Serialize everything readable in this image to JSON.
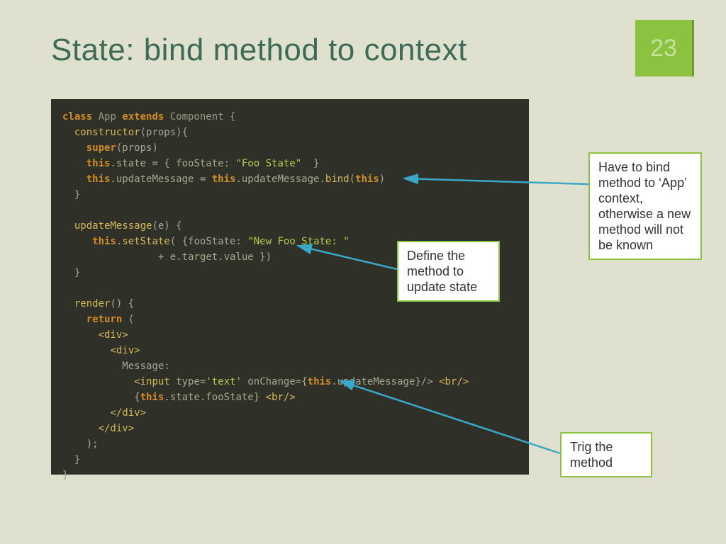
{
  "page_number": "23",
  "title": "State: bind method to context",
  "callouts": {
    "bind_note": "Have to bind method to ‘App’ context, otherwise a new method will not be known",
    "define_note": "Define the method to update state",
    "trig_note": "Trig the method"
  },
  "code": {
    "l1": {
      "a": "class ",
      "b": "App ",
      "c": "extends ",
      "d": "Component {"
    },
    "l2": {
      "a": "  ",
      "b": "constructor",
      "c": "(props){"
    },
    "l3": {
      "a": "    ",
      "b": "super",
      "c": "(props)"
    },
    "l4": {
      "a": "    ",
      "b": "this",
      "c": ".state = { fooState: ",
      "d": "\"Foo State\"",
      "e": "  }"
    },
    "l5": {
      "a": "    ",
      "b": "this",
      "c": ".updateMessage = ",
      "d": "this",
      "e": ".updateMessage.",
      "f": "bind",
      "g": "(",
      "h": "this",
      "i": ")"
    },
    "l6": "  }",
    "l7": "",
    "l8": {
      "a": "  ",
      "b": "updateMessage",
      "c": "(e) {"
    },
    "l9": {
      "a": "     ",
      "b": "this",
      "c": ".",
      "d": "setState",
      "e": "( {fooState: ",
      "f": "\"New Foo State: \""
    },
    "l10": {
      "a": "                + e.target.value })"
    },
    "l11": "  }",
    "l12": "",
    "l13": {
      "a": "  ",
      "b": "render",
      "c": "() {"
    },
    "l14": {
      "a": "    ",
      "b": "return ",
      "c": "("
    },
    "l15": {
      "a": "      ",
      "b": "<div>"
    },
    "l16": {
      "a": "        ",
      "b": "<div>"
    },
    "l17": "          Message:",
    "l18": {
      "a": "            ",
      "b": "<input ",
      "c": "type=",
      "d": "'text' ",
      "e": "onChange={",
      "f": "this",
      "g": ".updateMessage}/> ",
      "h": "<br/>"
    },
    "l19": {
      "a": "            {",
      "b": "this",
      "c": ".state.fooState} ",
      "d": "<br/>"
    },
    "l20": {
      "a": "        ",
      "b": "</div>"
    },
    "l21": {
      "a": "      ",
      "b": "</div>"
    },
    "l22": "    );",
    "l23": "  }",
    "l24": "}"
  }
}
